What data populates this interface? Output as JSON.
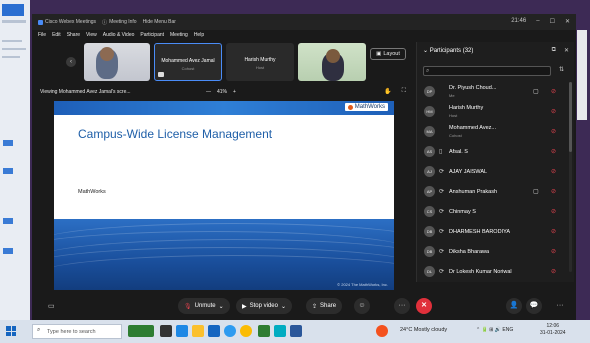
{
  "window": {
    "title_items": [
      "Cisco Webex Meetings",
      "Meeting Info",
      "Hide Menu Bar"
    ],
    "time": "21:46",
    "minimize": "–",
    "maximize": "☐",
    "close": "✕"
  },
  "menu": [
    "File",
    "Edit",
    "Share",
    "View",
    "Audio & Video",
    "Participant",
    "Meeting",
    "Help"
  ],
  "video_strip": {
    "tiles": [
      {
        "name": "",
        "role": ""
      },
      {
        "name": "Mohammed Avez Jamal",
        "role": "Cohost"
      },
      {
        "name": "Harish Murthy",
        "role": "Host"
      },
      {
        "name": "",
        "role": ""
      }
    ],
    "layout_label": "Layout"
  },
  "viewing": {
    "text": "Viewing Mohammed Avez Jamal's scre...",
    "zoom_minus": "—",
    "zoom_level": "41%",
    "zoom_plus": "+"
  },
  "slide": {
    "brand": "MathWorks",
    "title": "Campus-Wide License Management",
    "subtitle": "MathWorks",
    "copyright": "© 2024 The MathWorks, Inc."
  },
  "participants": {
    "title": "Participants (32)",
    "search_placeholder": "",
    "list": [
      {
        "initials": "DP",
        "name": "Dr. Piyush Choud...",
        "role": "Me",
        "status": "",
        "video": "▢",
        "muted": true
      },
      {
        "initials": "HM",
        "name": "Harish Murthy",
        "role": "Host",
        "status": "",
        "video": "",
        "muted": true
      },
      {
        "initials": "MA",
        "name": "Mohammed Avez...",
        "role": "Cohost",
        "status": "⟳",
        "video": "",
        "muted": true
      },
      {
        "initials": "AS",
        "name": "Afsal. S",
        "role": "",
        "status": "▯",
        "video": "",
        "muted": true
      },
      {
        "initials": "AJ",
        "name": "AJAY JAISWAL",
        "role": "",
        "status": "⟳",
        "video": "",
        "muted": true
      },
      {
        "initials": "AP",
        "name": "Anshuman Prakash",
        "role": "",
        "status": "⟳",
        "video": "▢",
        "muted": true
      },
      {
        "initials": "CS",
        "name": "Chinmay S",
        "role": "",
        "status": "⟳",
        "video": "",
        "muted": true
      },
      {
        "initials": "DB",
        "name": "DHARMESH BARODIYA",
        "role": "",
        "status": "⟳",
        "video": "",
        "muted": true
      },
      {
        "initials": "DB",
        "name": "Diksha Bharawa",
        "role": "",
        "status": "⟳",
        "video": "",
        "muted": true
      },
      {
        "initials": "DL",
        "name": "Dr Lokesh Kumar Noriwal",
        "role": "",
        "status": "⟳",
        "video": "",
        "muted": true
      }
    ]
  },
  "toolbar": {
    "unmute": "Unmute",
    "stop_video": "Stop video",
    "share": "Share",
    "reactions": "☺",
    "more": "···",
    "end": "✕"
  },
  "taskbar": {
    "search_placeholder": "Type here to search",
    "weather": "24°C  Mostly cloudy",
    "lang": "ENG",
    "time": "12:06",
    "date": "31-01-2024"
  },
  "colors": {
    "accent": "#4a8cf7",
    "end_red": "#e0303b",
    "muted_red": "#e0424e",
    "slide_blue": "#1f5fa8"
  }
}
